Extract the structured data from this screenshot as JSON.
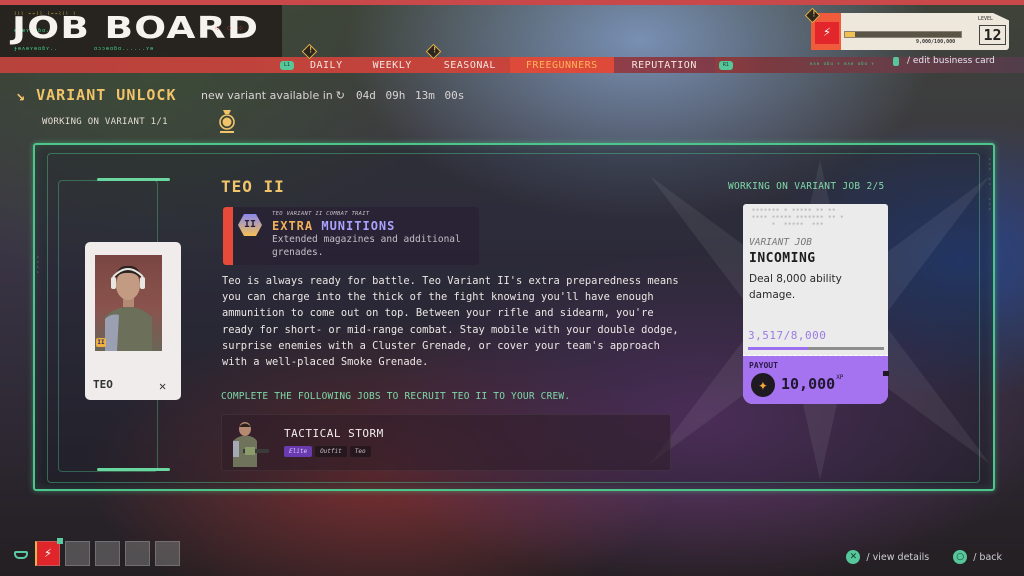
{
  "header": {
    "title": "JOB BOARD",
    "glyphs_top": "⌇⌇⌇ ⌁⌁⌇⌇ ⌇⌁⌁⌇⌇⌇ ⌇",
    "glyphs_left": "ɟɵʌɵʏɵɑɓʏ..",
    "glyphs_mid": "ɑɔɔɵɑɓɑ......ʏɵ",
    "glyphs_small": "ɵʌɵʏɵɑɓɑ..",
    "red_dots": "⁘ ⁘ ⁘"
  },
  "tabs": {
    "left_hint": "L1",
    "right_hint": "R1",
    "items": [
      {
        "label": "DAILY",
        "alert": true,
        "active": false
      },
      {
        "label": "WEEKLY",
        "alert": false,
        "active": false
      },
      {
        "label": "SEASONAL",
        "alert": true,
        "active": false
      },
      {
        "label": "FREEGUNNERS",
        "alert": false,
        "active": true
      },
      {
        "label": "REPUTATION",
        "alert": false,
        "active": false
      }
    ],
    "alert_glyph": "!"
  },
  "business_card": {
    "alert_glyph": "!",
    "logo_glyph": "⚡",
    "xp_text": "9,000/100,000",
    "xp_progress": 0.09,
    "level_label": "LEVEL",
    "level": "12",
    "edit_label": "/ edit business card",
    "edit_glyphs": "ɵʌɵ ɑɓɑ ʏ ɵʌɵ ɑɓɑ ʏ"
  },
  "variant_unlock": {
    "arrow_glyph": "↘",
    "title": "VARIANT UNLOCK",
    "timer_label": "new variant available in",
    "timer_icon": "↻",
    "timer_value": "04d 09h 13m 00s",
    "working_label": "WORKING ON VARIANT 1/1"
  },
  "character": {
    "name": "TEO",
    "badge": "II",
    "class_icon": "✕"
  },
  "variant": {
    "name": "TEO II",
    "trait": {
      "subtitle": "TEO VARIANT II COMBAT TRAIT",
      "title_word1": "EXTRA",
      "title_word2": "MUNITIONS",
      "icon": "II",
      "description": "Extended magazines and additional grenades."
    },
    "lore": "Teo is always ready for battle. Teo Variant II's extra preparedness means you can charge into the thick of the fight knowing you'll have enough ammunition to come out on top. Between your rifle and sidearm, you're ready for short- or mid-range combat. Stay mobile with your double dodge, surprise enemies with a Cluster Grenade, or cover your team's approach with a well-placed Smoke Grenade.",
    "complete_label": "COMPLETE THE FOLLOWING JOBS TO RECRUIT TEO II TO YOUR CREW.",
    "job": {
      "name": "TACTICAL STORM",
      "tags": [
        "Elite",
        "Outfit",
        "Teo"
      ]
    }
  },
  "variant_job": {
    "progress_label": "WORKING ON VARIANT JOB 2/5",
    "noise": "▪▪▪▪▪▪▪ ▪ ▪▪▪▪▪ ▪▪ ▪▪\n▪▪▪▪ ▪▪▪▪▪ ▪▪▪▪▪▪▪ ▪▪ ▪\n     ▪  ▪▪▪▪▪  ▪▪▪",
    "type": "VARIANT JOB",
    "name": "INCOMING",
    "description": "Deal 8,000 ability damage.",
    "count": "3,517/8,000",
    "progress": 0.44,
    "payout_label": "PAYOUT",
    "payout_icon": "✦",
    "payout_value": "10,000",
    "payout_unit": "XP"
  },
  "bottom": {
    "active_slot_glyph": "⚡",
    "empty_slots": 4,
    "hints": [
      {
        "button": "✕",
        "label": "/ view details"
      },
      {
        "button": "○",
        "label": "/ back"
      }
    ]
  },
  "colors": {
    "accent_green": "#4ec58a",
    "accent_gold": "#f1c46a",
    "accent_red": "#de4a3a",
    "accent_purple": "#a573f0"
  }
}
